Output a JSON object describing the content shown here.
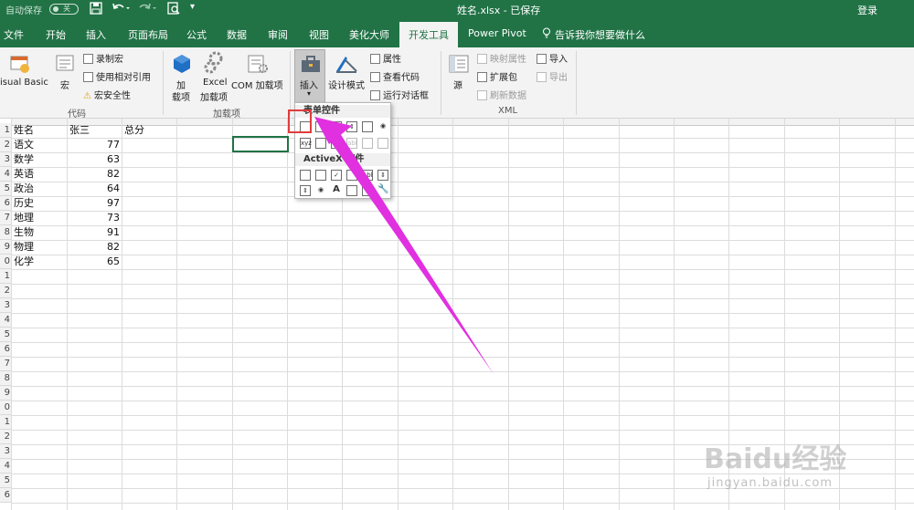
{
  "titlebar": {
    "autosave_label": "自动保存",
    "autosave_state": "关",
    "title": "姓名.xlsx - 已保存",
    "login": "登录",
    "qat": [
      "save-icon",
      "undo-icon",
      "redo-icon",
      "print-preview-icon",
      "customize-icon"
    ]
  },
  "tabs": [
    {
      "label": "文件"
    },
    {
      "label": "开始"
    },
    {
      "label": "插入"
    },
    {
      "label": "页面布局"
    },
    {
      "label": "公式"
    },
    {
      "label": "数据"
    },
    {
      "label": "审阅"
    },
    {
      "label": "视图"
    },
    {
      "label": "美化大师"
    },
    {
      "label": "开发工具",
      "active": true
    },
    {
      "label": "Power Pivot"
    },
    {
      "label": "告诉我你想要做什么"
    }
  ],
  "ribbon": {
    "code": {
      "group_label": "代码",
      "visual_basic": "isual Basic",
      "macros": "宏",
      "record_macro": "录制宏",
      "relative_ref": "使用相对引用",
      "macro_security": "宏安全性"
    },
    "addins": {
      "group_label": "加载项",
      "addins_line1": "加",
      "addins_line2": "载项",
      "excel_addins_line1": "Excel",
      "excel_addins_line2": "加载项",
      "com_addins": "COM 加载项"
    },
    "controls": {
      "insert": "插入",
      "design_mode": "设计模式",
      "properties": "属性",
      "view_code": "查看代码",
      "run_dialog": "运行对话框"
    },
    "xml": {
      "group_label": "XML",
      "source": "源",
      "map_properties": "映射属性",
      "expansion_packs": "扩展包",
      "refresh_data": "刷新数据",
      "import": "导入",
      "export": "导出"
    }
  },
  "dropdown": {
    "form_controls_header": "表单控件",
    "activex_header": "ActiveX 控件"
  },
  "sheet": {
    "header_row": {
      "a": "姓名",
      "b": "张三",
      "c": "总分"
    },
    "rows": [
      {
        "subject": "语文",
        "score": "77"
      },
      {
        "subject": "数学",
        "score": "63"
      },
      {
        "subject": "英语",
        "score": "82"
      },
      {
        "subject": "政治",
        "score": "64"
      },
      {
        "subject": "历史",
        "score": "97"
      },
      {
        "subject": "地理",
        "score": "73"
      },
      {
        "subject": "生物",
        "score": "91"
      },
      {
        "subject": "物理",
        "score": "82"
      },
      {
        "subject": "化学",
        "score": "65"
      }
    ],
    "row_numbers": [
      "1",
      "2",
      "3",
      "4",
      "5",
      "6",
      "7",
      "8",
      "9",
      "0",
      "1",
      "2",
      "3",
      "4",
      "5",
      "6",
      "7",
      "8",
      "9",
      "0",
      "1",
      "2",
      "3",
      "4",
      "5",
      "6"
    ]
  },
  "watermark": {
    "brand": "Baidu经验",
    "url": "jingyan.baidu.com"
  },
  "colors": {
    "excel_green": "#217346",
    "highlight_red": "#e03c3c",
    "arrow_magenta": "#e030e0"
  }
}
